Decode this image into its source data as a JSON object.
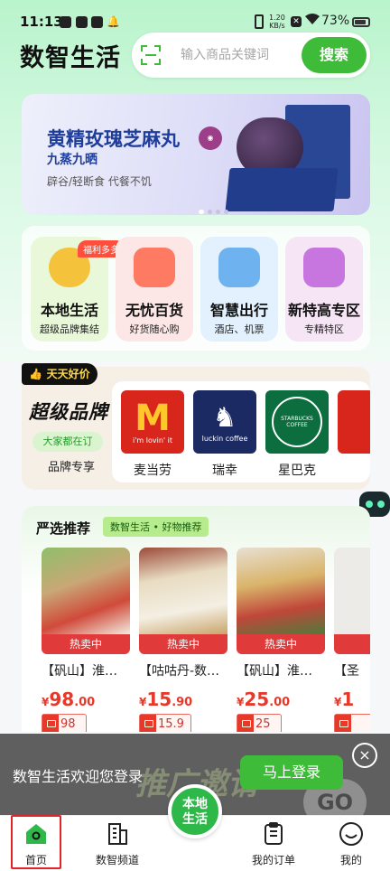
{
  "status_bar": {
    "time": "11:13",
    "net_speed": [
      "1.20",
      "KB/s"
    ],
    "battery": "73%"
  },
  "header": {
    "app_name": "数智生活",
    "search_placeholder": "输入商品关键词",
    "search_button": "搜索"
  },
  "banner": {
    "title": "黄精玫瑰芝麻丸",
    "subtitle": "九蒸九晒",
    "tagline": "辟谷/轻断食 代餐不饥"
  },
  "categories": [
    {
      "name": "本地生活",
      "sub": "超级品牌集结",
      "badge": "福利多多",
      "color": "#e9f8d8",
      "art": "#f5c33b"
    },
    {
      "name": "无忧百货",
      "sub": "好货随心购",
      "color": "#fde7e6",
      "art": "#ff7a63"
    },
    {
      "name": "智慧出行",
      "sub": "酒店、机票",
      "color": "#e2f1fd",
      "art": "#6fb2f0"
    },
    {
      "name": "新特高专区",
      "sub": "专精特区",
      "color": "#f6e5f5",
      "art": "#c776e0"
    }
  ],
  "brand_section": {
    "badge": "天天好价",
    "headline": "超级品牌",
    "pill": "大家都在订",
    "link": "品牌专享",
    "brands": [
      {
        "name": "麦当劳",
        "logo_text": "i'm lovin' it",
        "color": "#d8261c"
      },
      {
        "name": "瑞幸",
        "logo_text": "luckin coffee",
        "color": "#1c2a63"
      },
      {
        "name": "星巴克",
        "logo_text": "STARBUCKS COFFEE",
        "color": "#0c6e3f"
      }
    ]
  },
  "recommend": {
    "title": "严选推荐",
    "tag": "数智生活 • 好物推荐",
    "products": [
      {
        "hot": "热卖中",
        "name": "【矾山】淮…",
        "currency": "¥",
        "price_int": "98",
        "price_dec": ".00",
        "coupon": "98"
      },
      {
        "hot": "热卖中",
        "name": "【咕咕丹-数…",
        "currency": "¥",
        "price_int": "15",
        "price_dec": ".90",
        "coupon": "15.9"
      },
      {
        "hot": "热卖中",
        "name": "【矾山】淮…",
        "currency": "¥",
        "price_int": "25",
        "price_dec": ".00",
        "coupon": "25"
      },
      {
        "hot": "",
        "name": "【圣",
        "currency": "¥",
        "price_int": "1",
        "price_dec": "",
        "coupon": ""
      }
    ]
  },
  "login_bar": {
    "message": "数智生活欢迎您登录",
    "button": "马上登录",
    "close": "×"
  },
  "nav": {
    "items": [
      {
        "label": "首页",
        "icon": "home-icon"
      },
      {
        "label": "数智频道",
        "icon": "building-icon"
      },
      {
        "label": "我的订单",
        "icon": "orders-icon"
      },
      {
        "label": "我的",
        "icon": "profile-icon"
      }
    ],
    "center": [
      "本地",
      "生活"
    ]
  }
}
